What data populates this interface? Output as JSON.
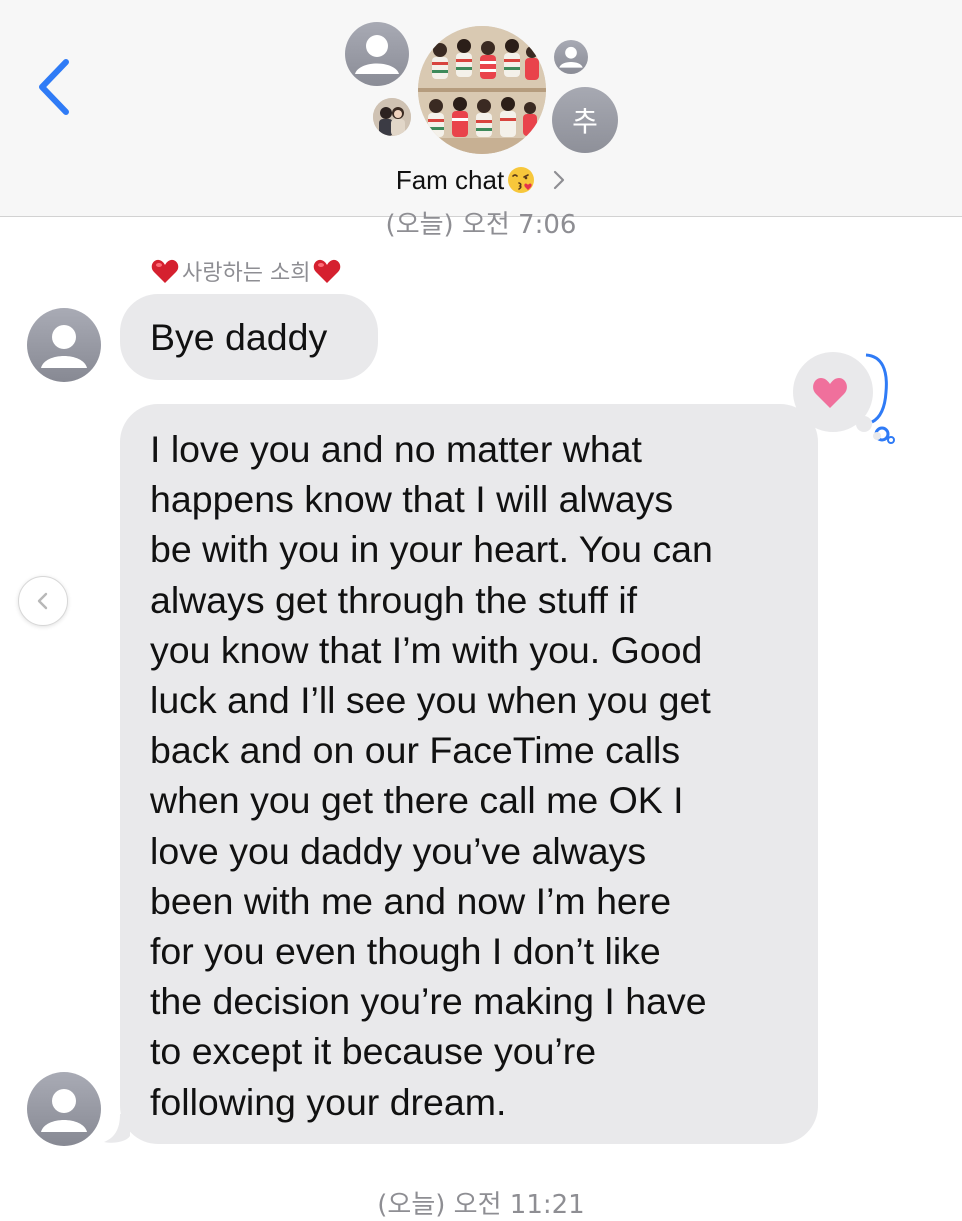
{
  "header": {
    "chat_name": "Fam chat",
    "chat_name_emoji": "face-blowing-kiss-icon",
    "initial_avatar": "추",
    "accent_color": "#2f7bf6"
  },
  "timestamps": {
    "top": "(오늘) 오전 7:06",
    "bottom": "(오늘) 오전 11:21"
  },
  "sender": {
    "name": "사랑하는 소희",
    "name_decoration": "red-heart-icon"
  },
  "messages": [
    {
      "text": "Bye daddy"
    },
    {
      "text": "I love you and no matter what\nhappens know that I will always\nbe with you in your heart. You can\nalways get through the stuff if\nyou know that I’m with you. Good\nluck and I’ll see you when you get\nback and on our FaceTime calls\nwhen you get there call me OK I\nlove you daddy you’ve always\nbeen with me and now I’m here\nfor you even though I don’t like\nthe decision you’re making I have\nto except it because you’re\nfollowing your dream."
    }
  ],
  "reaction": {
    "type": "heart",
    "color": "#f0709c"
  },
  "colors": {
    "bubble": "#e9e9eb",
    "timestamp": "#8e8e93",
    "header_bg": "#f7f7f7"
  }
}
